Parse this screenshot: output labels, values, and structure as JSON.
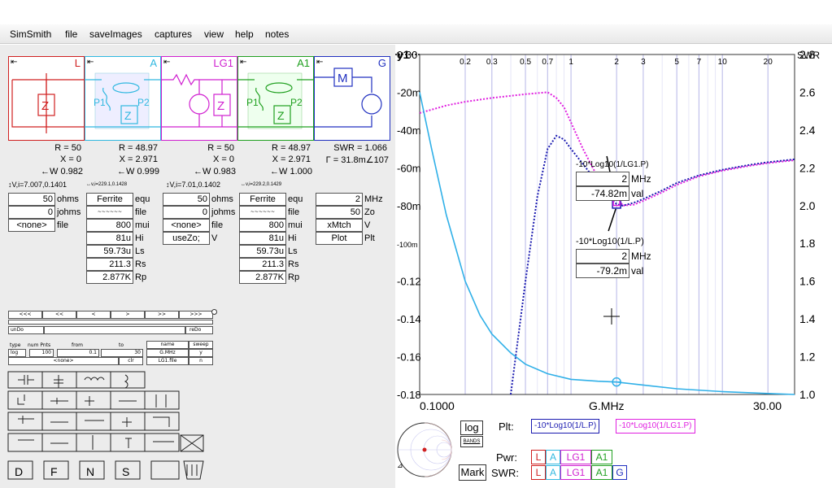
{
  "menu": [
    "SimSmith",
    "file",
    "saveImages",
    "captures",
    "view",
    "help",
    "notes"
  ],
  "elements": [
    {
      "label": "L",
      "color": "#d02020",
      "params": [
        "R = 50",
        "X = 0",
        "←W 0.982"
      ],
      "vi": "↕V,i=7.007,0.1401"
    },
    {
      "label": "A",
      "color": "#30b8e0",
      "params": [
        "R = 48.97",
        "X = 2.971",
        "←W 0.999"
      ],
      "vi": "↔v,i=229.1,0.1428"
    },
    {
      "label": "LG1",
      "color": "#d020d0",
      "params": [
        "R = 50",
        "X = 0",
        "←W 0.983"
      ],
      "vi": "↕V,i=7.01,0.1402"
    },
    {
      "label": "A1",
      "color": "#20a020",
      "params": [
        "R = 48.97",
        "X = 2.971",
        "←W 1.000"
      ],
      "vi": "↔v,i=229.2,0.1429"
    },
    {
      "label": "G",
      "color": "#2030c0",
      "params": [
        "SWR = 1.066",
        "Γ = 31.8m∠107"
      ],
      "vi": ""
    }
  ],
  "L_inputs": [
    {
      "value": "50",
      "unit": "ohms"
    },
    {
      "value": "0",
      "unit": "johms"
    },
    {
      "value": "<none>",
      "unit": "file"
    }
  ],
  "A_inputs": [
    {
      "value": "Ferrite",
      "unit": "equ"
    },
    {
      "value": "~~~~~~",
      "unit": "file"
    },
    {
      "value": "800",
      "unit": "mui"
    },
    {
      "value": "81u",
      "unit": "Hi"
    },
    {
      "value": "59.73u",
      "unit": "Ls"
    },
    {
      "value": "211.3",
      "unit": "Rs"
    },
    {
      "value": "2.877K",
      "unit": "Rp"
    }
  ],
  "LG1_inputs": [
    {
      "value": "50",
      "unit": "ohms"
    },
    {
      "value": "0",
      "unit": "johms"
    },
    {
      "value": "<none>",
      "unit": "file"
    },
    {
      "value": "useZo;",
      "unit": "V"
    }
  ],
  "A1_inputs": [
    {
      "value": "Ferrite",
      "unit": "equ"
    },
    {
      "value": "~~~~~~",
      "unit": "file"
    },
    {
      "value": "800",
      "unit": "mui"
    },
    {
      "value": "81u",
      "unit": "Hi"
    },
    {
      "value": "59.73u",
      "unit": "Ls"
    },
    {
      "value": "211.3",
      "unit": "Rs"
    },
    {
      "value": "2.877K",
      "unit": "Rp"
    }
  ],
  "G_inputs": [
    {
      "value": "2",
      "unit": "MHz"
    },
    {
      "value": "50",
      "unit": "Zo"
    },
    {
      "value": "xMtch",
      "unit": "V"
    },
    {
      "value": "Plot",
      "unit": "Plt"
    }
  ],
  "nav_buttons": [
    "<<<",
    "<<",
    "<",
    ">",
    ">>",
    ">>>"
  ],
  "undo": "unDo",
  "redo": "reDo",
  "sweep": {
    "headers": [
      "type",
      "num Pnts",
      "from",
      "to",
      "name",
      "sweep"
    ],
    "values": [
      "log",
      "100",
      "0.1",
      "30",
      "G.MHz",
      "y"
    ],
    "row3": [
      "<none>",
      "clr",
      "LG1.file",
      "n"
    ]
  },
  "chart": {
    "yaxis_label": "y1",
    "y2axis_label": "SWR",
    "xlabel": "G.MHz",
    "x_min_label": "0.1000",
    "x_max_label": "30.00"
  },
  "chart_data": {
    "type": "line",
    "x_scale": "log",
    "xlim": [
      0.1,
      30
    ],
    "ylim": [
      -0.18,
      0.0
    ],
    "y2lim": [
      1.0,
      2.8
    ],
    "x_ticks": [
      "0.2",
      "0.3",
      "0.5",
      "0.7",
      "1",
      "2",
      "3",
      "5",
      "7",
      "10",
      "20"
    ],
    "y_ticks": [
      "0.00",
      "-20m",
      "-40m",
      "-60m",
      "-80m",
      "-100m",
      "-0.12",
      "-0.14",
      "-0.16",
      "-0.18"
    ],
    "y2_ticks": [
      "2.8",
      "2.6",
      "2.4",
      "2.2",
      "2.0",
      "1.8",
      "1.6",
      "1.4",
      "1.2",
      "1.0"
    ],
    "series": [
      {
        "name": "-10*Log10(1/L.P)",
        "color": "#1a1ab0",
        "style": "dotted",
        "x": [
          0.4,
          0.5,
          0.6,
          0.7,
          0.8,
          0.9,
          1.0,
          1.2,
          1.5,
          1.8,
          2.0,
          2.2,
          2.6,
          3.0,
          4.0,
          5.0,
          7.0,
          10,
          15,
          20,
          30
        ],
        "y": [
          -0.18,
          -0.12,
          -0.075,
          -0.05,
          -0.043,
          -0.045,
          -0.05,
          -0.058,
          -0.068,
          -0.076,
          -0.0792,
          -0.08,
          -0.0785,
          -0.0765,
          -0.072,
          -0.068,
          -0.064,
          -0.061,
          -0.0585,
          -0.057,
          -0.0555
        ]
      },
      {
        "name": "-10*Log10(1/LG1.P)",
        "color": "#e020e0",
        "style": "dotted",
        "x": [
          0.1,
          0.15,
          0.2,
          0.3,
          0.5,
          0.7,
          0.8,
          0.9,
          1.0,
          1.2,
          1.5,
          1.8,
          2.0,
          2.2,
          2.6,
          3.0,
          4.0,
          5.0,
          7.0,
          10,
          15,
          20,
          30
        ],
        "y": [
          -0.031,
          -0.027,
          -0.025,
          -0.023,
          -0.021,
          -0.02,
          -0.023,
          -0.028,
          -0.036,
          -0.05,
          -0.065,
          -0.074,
          -0.0748,
          -0.08,
          -0.0795,
          -0.0775,
          -0.073,
          -0.069,
          -0.0645,
          -0.0615,
          -0.059,
          -0.0575,
          -0.056
        ]
      },
      {
        "name": "SWR",
        "color": "#30b0e8",
        "style": "solid",
        "x": [
          0.1,
          0.12,
          0.15,
          0.2,
          0.25,
          0.3,
          0.4,
          0.5,
          0.7,
          1.0,
          1.5,
          2.0,
          3.0,
          5.0,
          10,
          20,
          30
        ],
        "y": [
          2.6,
          2.3,
          1.95,
          1.6,
          1.42,
          1.32,
          1.22,
          1.16,
          1.11,
          1.08,
          1.07,
          1.066,
          1.05,
          1.03,
          1.015,
          1.005,
          1.0
        ]
      }
    ],
    "markers": [
      {
        "title": "-10*Log10(1/LG1.P)",
        "freq": "2",
        "freq_unit": "MHz",
        "value": "-74.82m",
        "value_unit": "val"
      },
      {
        "title": "-10*Log10(1/L.P)",
        "freq": "2",
        "freq_unit": "MHz",
        "value": "-79.2m",
        "value_unit": "val"
      }
    ]
  },
  "bottom": {
    "log_btn": "log",
    "bands_btn": "BANDS",
    "mark_btn": "Mark",
    "plt_label": "Plt:",
    "plt_items": [
      "-10*Log10(1/L.P)",
      "-10*Log10(1/LG1.P)"
    ],
    "pwr_label": "Pwr:",
    "swr_label": "SWR:",
    "pwr_items": [
      "L",
      "A",
      "LG1",
      "A1"
    ],
    "swr_items": [
      "L",
      "A",
      "LG1",
      "A1",
      "G"
    ]
  }
}
